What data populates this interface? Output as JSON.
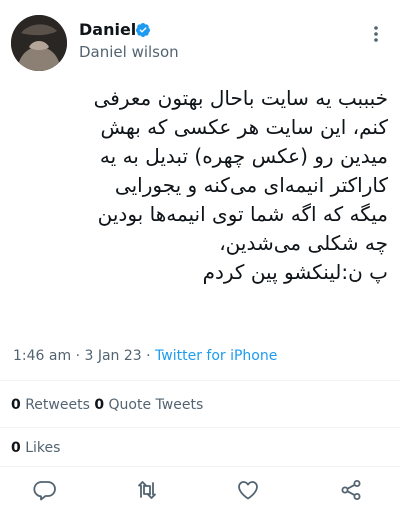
{
  "author": {
    "name": "Daniel",
    "handle": "Daniel wilson"
  },
  "tweet": {
    "lines": [
      "خبببب یه سایت باحال بهتون معرفی",
      "کنم، این سایت هر عکسی که بهش",
      "میدین رو (عکس چهره) تبدیل به یه",
      "کاراکتر انیمه‌ای می‌کنه و یجورایی",
      "میگه که اگه شما توی انیمه‌ها بودین",
      "چه شکلی می‌شدین،",
      "پ ن:لینکشو پین کردم"
    ]
  },
  "meta": {
    "time": "1:46 am",
    "dot": "·",
    "date": "3 Jan 23",
    "source": "Twitter for iPhone"
  },
  "stats": {
    "retweets_count": "0",
    "retweets_label": "Retweets",
    "quotes_count": "0",
    "quotes_label": "Quote Tweets",
    "likes_count": "0",
    "likes_label": "Likes"
  },
  "actions": [
    "reply-icon",
    "retweet-icon",
    "like-icon",
    "share-icon"
  ],
  "colors": {
    "accent": "#1d9bf0",
    "text": "#0f1419",
    "muted": "#536471",
    "divider": "#eff3f4"
  }
}
